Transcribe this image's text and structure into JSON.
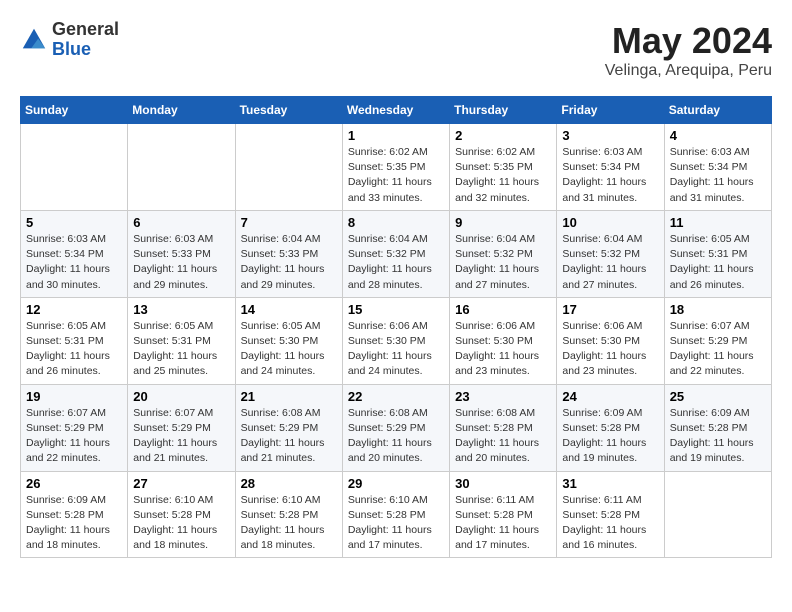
{
  "logo": {
    "general": "General",
    "blue": "Blue"
  },
  "header": {
    "month_year": "May 2024",
    "location": "Velinga, Arequipa, Peru"
  },
  "weekdays": [
    "Sunday",
    "Monday",
    "Tuesday",
    "Wednesday",
    "Thursday",
    "Friday",
    "Saturday"
  ],
  "weeks": [
    [
      {
        "day": "",
        "info": ""
      },
      {
        "day": "",
        "info": ""
      },
      {
        "day": "",
        "info": ""
      },
      {
        "day": "1",
        "info": "Sunrise: 6:02 AM\nSunset: 5:35 PM\nDaylight: 11 hours\nand 33 minutes."
      },
      {
        "day": "2",
        "info": "Sunrise: 6:02 AM\nSunset: 5:35 PM\nDaylight: 11 hours\nand 32 minutes."
      },
      {
        "day": "3",
        "info": "Sunrise: 6:03 AM\nSunset: 5:34 PM\nDaylight: 11 hours\nand 31 minutes."
      },
      {
        "day": "4",
        "info": "Sunrise: 6:03 AM\nSunset: 5:34 PM\nDaylight: 11 hours\nand 31 minutes."
      }
    ],
    [
      {
        "day": "5",
        "info": "Sunrise: 6:03 AM\nSunset: 5:34 PM\nDaylight: 11 hours\nand 30 minutes."
      },
      {
        "day": "6",
        "info": "Sunrise: 6:03 AM\nSunset: 5:33 PM\nDaylight: 11 hours\nand 29 minutes."
      },
      {
        "day": "7",
        "info": "Sunrise: 6:04 AM\nSunset: 5:33 PM\nDaylight: 11 hours\nand 29 minutes."
      },
      {
        "day": "8",
        "info": "Sunrise: 6:04 AM\nSunset: 5:32 PM\nDaylight: 11 hours\nand 28 minutes."
      },
      {
        "day": "9",
        "info": "Sunrise: 6:04 AM\nSunset: 5:32 PM\nDaylight: 11 hours\nand 27 minutes."
      },
      {
        "day": "10",
        "info": "Sunrise: 6:04 AM\nSunset: 5:32 PM\nDaylight: 11 hours\nand 27 minutes."
      },
      {
        "day": "11",
        "info": "Sunrise: 6:05 AM\nSunset: 5:31 PM\nDaylight: 11 hours\nand 26 minutes."
      }
    ],
    [
      {
        "day": "12",
        "info": "Sunrise: 6:05 AM\nSunset: 5:31 PM\nDaylight: 11 hours\nand 26 minutes."
      },
      {
        "day": "13",
        "info": "Sunrise: 6:05 AM\nSunset: 5:31 PM\nDaylight: 11 hours\nand 25 minutes."
      },
      {
        "day": "14",
        "info": "Sunrise: 6:05 AM\nSunset: 5:30 PM\nDaylight: 11 hours\nand 24 minutes."
      },
      {
        "day": "15",
        "info": "Sunrise: 6:06 AM\nSunset: 5:30 PM\nDaylight: 11 hours\nand 24 minutes."
      },
      {
        "day": "16",
        "info": "Sunrise: 6:06 AM\nSunset: 5:30 PM\nDaylight: 11 hours\nand 23 minutes."
      },
      {
        "day": "17",
        "info": "Sunrise: 6:06 AM\nSunset: 5:30 PM\nDaylight: 11 hours\nand 23 minutes."
      },
      {
        "day": "18",
        "info": "Sunrise: 6:07 AM\nSunset: 5:29 PM\nDaylight: 11 hours\nand 22 minutes."
      }
    ],
    [
      {
        "day": "19",
        "info": "Sunrise: 6:07 AM\nSunset: 5:29 PM\nDaylight: 11 hours\nand 22 minutes."
      },
      {
        "day": "20",
        "info": "Sunrise: 6:07 AM\nSunset: 5:29 PM\nDaylight: 11 hours\nand 21 minutes."
      },
      {
        "day": "21",
        "info": "Sunrise: 6:08 AM\nSunset: 5:29 PM\nDaylight: 11 hours\nand 21 minutes."
      },
      {
        "day": "22",
        "info": "Sunrise: 6:08 AM\nSunset: 5:29 PM\nDaylight: 11 hours\nand 20 minutes."
      },
      {
        "day": "23",
        "info": "Sunrise: 6:08 AM\nSunset: 5:28 PM\nDaylight: 11 hours\nand 20 minutes."
      },
      {
        "day": "24",
        "info": "Sunrise: 6:09 AM\nSunset: 5:28 PM\nDaylight: 11 hours\nand 19 minutes."
      },
      {
        "day": "25",
        "info": "Sunrise: 6:09 AM\nSunset: 5:28 PM\nDaylight: 11 hours\nand 19 minutes."
      }
    ],
    [
      {
        "day": "26",
        "info": "Sunrise: 6:09 AM\nSunset: 5:28 PM\nDaylight: 11 hours\nand 18 minutes."
      },
      {
        "day": "27",
        "info": "Sunrise: 6:10 AM\nSunset: 5:28 PM\nDaylight: 11 hours\nand 18 minutes."
      },
      {
        "day": "28",
        "info": "Sunrise: 6:10 AM\nSunset: 5:28 PM\nDaylight: 11 hours\nand 18 minutes."
      },
      {
        "day": "29",
        "info": "Sunrise: 6:10 AM\nSunset: 5:28 PM\nDaylight: 11 hours\nand 17 minutes."
      },
      {
        "day": "30",
        "info": "Sunrise: 6:11 AM\nSunset: 5:28 PM\nDaylight: 11 hours\nand 17 minutes."
      },
      {
        "day": "31",
        "info": "Sunrise: 6:11 AM\nSunset: 5:28 PM\nDaylight: 11 hours\nand 16 minutes."
      },
      {
        "day": "",
        "info": ""
      }
    ]
  ]
}
